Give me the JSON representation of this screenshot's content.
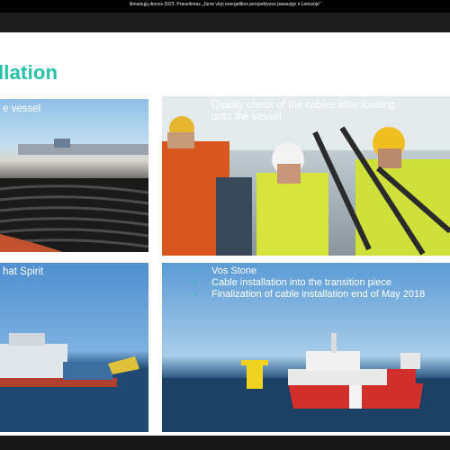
{
  "window": {
    "title": "Išmaniųjų dienos 2023. Pranešimas „Jūros vėjo energetikos perspektyvos pasaulyje ir Lietuvoje“"
  },
  "slide": {
    "heading": "llation",
    "panels": {
      "top_left_caption": "e vessel",
      "top_right_caption": [
        "Quality check of the cables after loading",
        "onto the vessel"
      ],
      "bottom_left_caption": "hat Spirit",
      "bottom_right_bullets": [
        "Vos Stone",
        "Cable installation into the transition piece",
        "Finalization of cable installation end of May 2018"
      ]
    }
  },
  "colors": {
    "accent": "#27c1a8"
  }
}
